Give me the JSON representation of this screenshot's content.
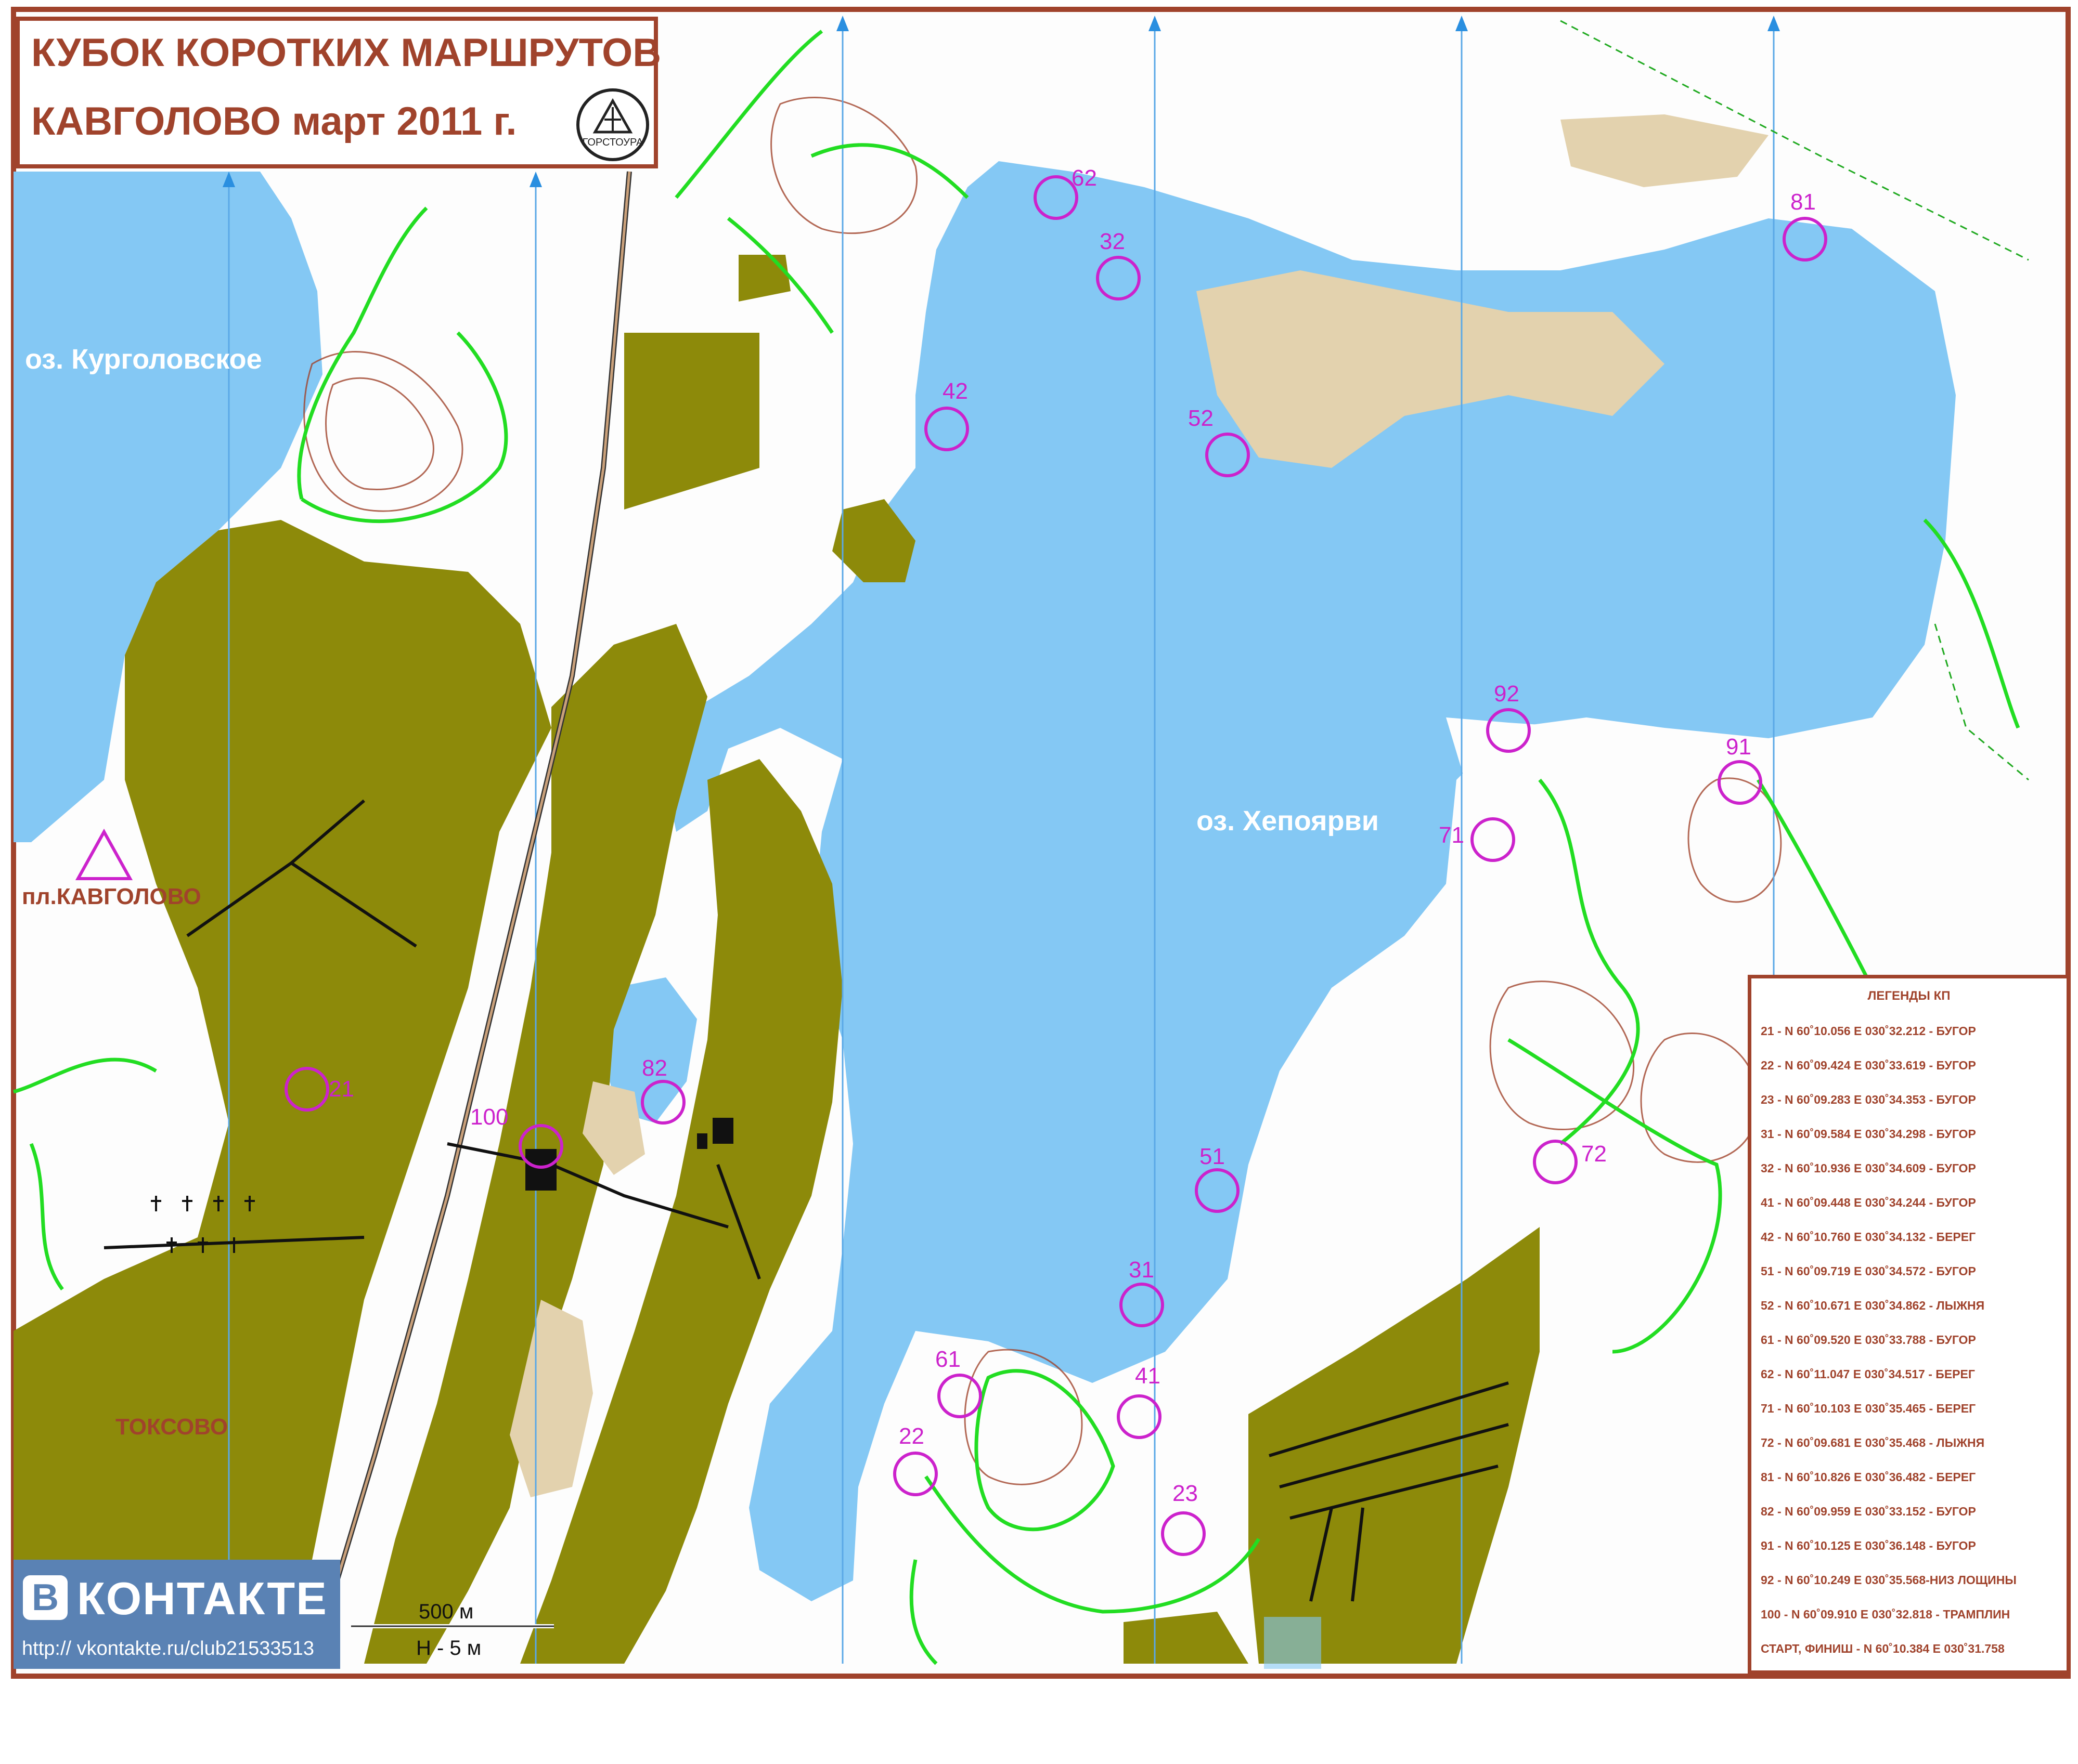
{
  "title": {
    "line1": "КУБОК КОРОТКИХ МАРШРУТОВ",
    "line2": "КАВГОЛОВО  март 2011 г.",
    "logo_text": "ГОРСТОУРА"
  },
  "labels": {
    "lake_kurgolovskoe": "оз. Курголовское",
    "lake_hepoyarvi": "оз. Хепоярви",
    "station": "пл.КАВГОЛОВО",
    "town": "ТОКСОВО"
  },
  "control_points": [
    {
      "id": "21"
    },
    {
      "id": "22"
    },
    {
      "id": "23"
    },
    {
      "id": "31"
    },
    {
      "id": "32"
    },
    {
      "id": "41"
    },
    {
      "id": "42"
    },
    {
      "id": "51"
    },
    {
      "id": "52"
    },
    {
      "id": "61"
    },
    {
      "id": "62"
    },
    {
      "id": "71"
    },
    {
      "id": "72"
    },
    {
      "id": "81"
    },
    {
      "id": "82"
    },
    {
      "id": "91"
    },
    {
      "id": "92"
    },
    {
      "id": "100"
    }
  ],
  "legend": {
    "title": "ЛЕГЕНДЫ КП",
    "rows": [
      "21 - N 60˚10.056 E 030˚32.212 - БУГОР",
      "22 - N 60˚09.424 E 030˚33.619 - БУГОР",
      "23 - N 60˚09.283 E 030˚34.353 - БУГОР",
      "31 - N 60˚09.584 E 030˚34.298 - БУГОР",
      "32 - N 60˚10.936 E 030˚34.609 - БУГОР",
      "41 - N 60˚09.448 E 030˚34.244 - БУГОР",
      "42 - N 60˚10.760 E 030˚34.132 - БЕРЕГ",
      "51 - N 60˚09.719 E 030˚34.572 - БУГОР",
      "52 - N 60˚10.671 E 030˚34.862 - ЛЫЖНЯ",
      "61 - N 60˚09.520 E 030˚33.788 - БУГОР",
      "62 - N 60˚11.047 E 030˚34.517 - БЕРЕГ",
      "71 - N 60˚10.103 E 030˚35.465 - БЕРЕГ",
      "72 - N 60˚09.681 E 030˚35.468 - ЛЫЖНЯ",
      "81 - N 60˚10.826 E 030˚36.482 - БЕРЕГ",
      "82 - N 60˚09.959 E 030˚33.152 - БУГОР",
      "91 - N 60˚10.125 E 030˚36.148 - БУГОР",
      "92 - N 60˚10.249 E 030˚35.568-НИЗ ЛОЩИНЫ",
      "100 - N 60˚09.910 E 030˚32.818 - ТРАМПЛИН",
      "СТАРТ, ФИНИШ - N 60˚10.384 E 030˚31.758"
    ]
  },
  "scale": {
    "distance": "500 м",
    "contour": "H - 5 м"
  },
  "social": {
    "name": "КОНТАКТЕ",
    "logo_letter": "В",
    "url": "http:// vkontakte.ru/club21533513"
  },
  "colors": {
    "water": "#84c8f4",
    "forest": "#8d8a0a",
    "open": "#fdfdfd",
    "sand": "#e3d2ae",
    "contour": "#a0432c",
    "ski_track": "#22dd22",
    "control": "#cc22cc",
    "frame": "#a0432c"
  }
}
